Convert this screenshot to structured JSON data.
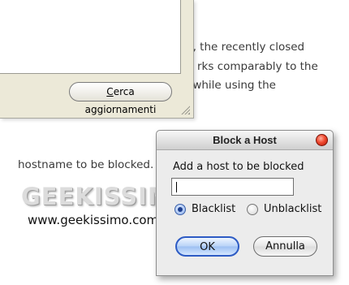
{
  "article": {
    "line1": "p, the recently closed",
    "line2": "rks comparably to the",
    "line3": "s while using the",
    "line4": "hostname to be blocked."
  },
  "update_panel": {
    "check_updates_button": "Cerca aggiornamenti",
    "check_updates_first_letter": "C",
    "check_updates_rest": "erca aggiornamenti"
  },
  "watermark": {
    "logo": "GEEKISSIMO",
    "url": "www.geekissimo.com"
  },
  "dialog": {
    "title": "Block a Host",
    "prompt": "Add a host to be blocked",
    "host_input_value": "",
    "options": [
      {
        "label": "Blacklist",
        "selected": true
      },
      {
        "label": "Unblacklist",
        "selected": false
      }
    ],
    "ok_label": "OK",
    "cancel_label": "Annulla"
  },
  "colors": {
    "dialog_bg": "#ececec",
    "close_button": "#f04a30",
    "ok_border": "#2d5bc4"
  }
}
